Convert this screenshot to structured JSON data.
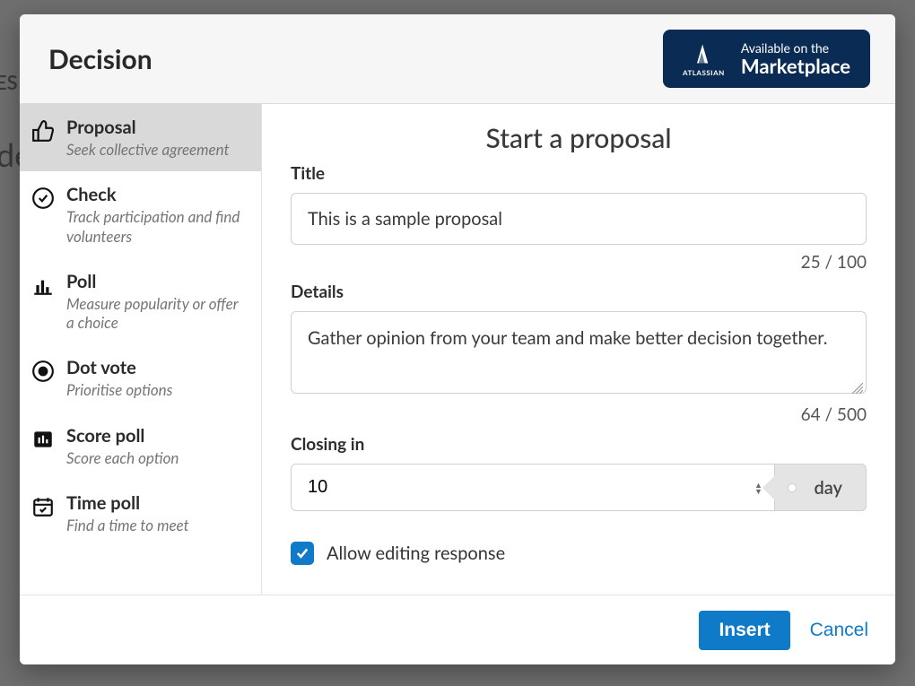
{
  "background": {
    "cropped1": "ES",
    "cropped2": "de"
  },
  "header": {
    "title": "Decision",
    "marketplace": {
      "vendor": "ATLASSIAN",
      "line1": "Available on the",
      "line2": "Marketplace"
    }
  },
  "sidebar": {
    "items": [
      {
        "label": "Proposal",
        "desc": "Seek collective agreement"
      },
      {
        "label": "Check",
        "desc": "Track participation and find volunteers"
      },
      {
        "label": "Poll",
        "desc": "Measure popularity or offer a choice"
      },
      {
        "label": "Dot vote",
        "desc": "Prioritise options"
      },
      {
        "label": "Score poll",
        "desc": "Score each option"
      },
      {
        "label": "Time poll",
        "desc": "Find a time to meet"
      }
    ]
  },
  "form": {
    "heading": "Start a proposal",
    "title_label": "Title",
    "title_value": "This is a sample proposal",
    "title_counter": "25 / 100",
    "details_label": "Details",
    "details_value": "Gather opinion from your team and make better decision together.",
    "details_counter": "64 / 500",
    "closing_label": "Closing in",
    "closing_value": "10",
    "closing_unit": "day",
    "allow_edit_label": "Allow editing response",
    "allow_edit_checked": true
  },
  "footer": {
    "insert": "Insert",
    "cancel": "Cancel"
  }
}
